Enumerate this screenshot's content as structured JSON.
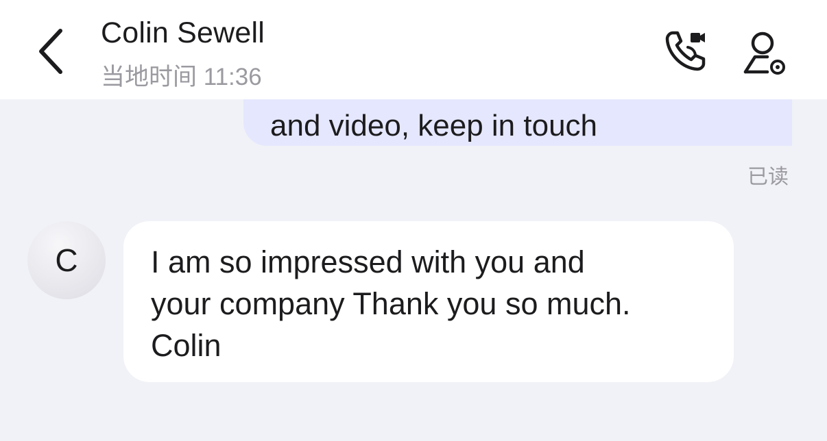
{
  "header": {
    "title": "Colin Sewell",
    "subtitle": "当地时间 11:36",
    "back_icon": "chevron-left-icon",
    "call_icon": "phone-video-icon",
    "profile_icon": "user-settings-icon"
  },
  "messages": {
    "outgoing": {
      "text": "and video, keep in touch",
      "status": "已读",
      "bubble_color": "#e5e7fe"
    },
    "incoming": {
      "avatar_initial": "C",
      "text": "I am so impressed with you and\nyour company Thank you so much.\nColin",
      "bubble_color": "#ffffff"
    }
  },
  "colors": {
    "background": "#f1f2f7",
    "header": "#ffffff",
    "text": "#1c1c1e",
    "muted": "#9a9aa0"
  }
}
